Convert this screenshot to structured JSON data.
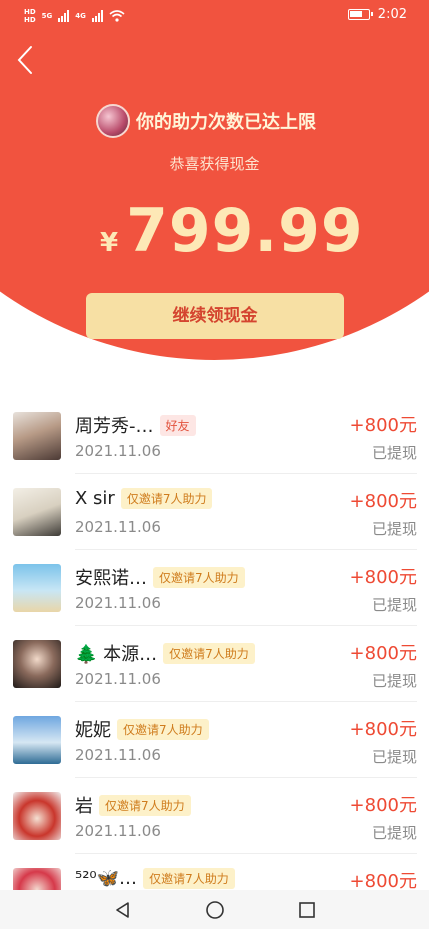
{
  "status_bar": {
    "left_tags": [
      "HD",
      "HD"
    ],
    "net_labels": [
      "5G",
      "4G"
    ],
    "time": "2:02"
  },
  "header": {
    "headline": "你的助力次数已达上限",
    "subtitle": "恭喜获得现金",
    "currency": "¥",
    "amount": "799.99",
    "cta_label": "继续领现金"
  },
  "records": [
    {
      "name": "周芳秀-…",
      "tag": "好友",
      "tag_kind": "friend",
      "date": "2021.11.06",
      "reward": "+800元",
      "status": "已提现"
    },
    {
      "name": "X sir",
      "tag": "仅邀请7人助力",
      "tag_kind": "invite",
      "date": "2021.11.06",
      "reward": "+800元",
      "status": "已提现"
    },
    {
      "name": "安熙诺…",
      "tag": "仅邀请7人助力",
      "tag_kind": "invite",
      "date": "2021.11.06",
      "reward": "+800元",
      "status": "已提现"
    },
    {
      "name": "🌲 本源…",
      "tag": "仅邀请7人助力",
      "tag_kind": "invite",
      "date": "2021.11.06",
      "reward": "+800元",
      "status": "已提现"
    },
    {
      "name": "妮妮",
      "tag": "仅邀请7人助力",
      "tag_kind": "invite",
      "date": "2021.11.06",
      "reward": "+800元",
      "status": "已提现"
    },
    {
      "name": "岩",
      "tag": "仅邀请7人助力",
      "tag_kind": "invite",
      "date": "2021.11.06",
      "reward": "+800元",
      "status": "已提现"
    },
    {
      "name": "⁵²⁰🦋…",
      "tag": "仅邀请7人助力",
      "tag_kind": "invite",
      "date": "",
      "reward": "+800元",
      "status": ""
    }
  ],
  "colors": {
    "hero_red": "#f1533f",
    "gold": "#fde8b6",
    "reward_red": "#ee4a34"
  }
}
